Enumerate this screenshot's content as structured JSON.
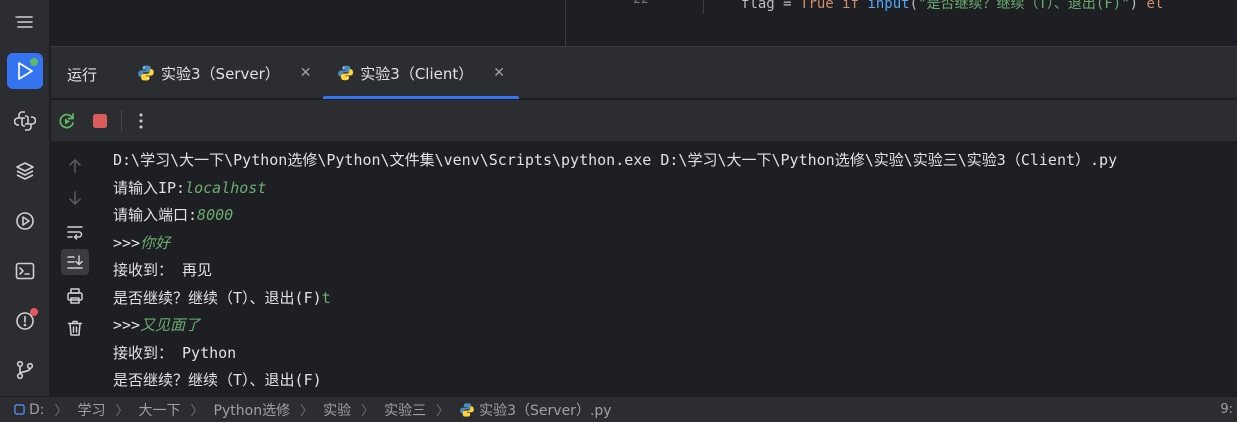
{
  "editor": {
    "line_number": "22",
    "code": {
      "ident": "flag",
      "eq": " = ",
      "kw_true": "True",
      "kw_if": " if ",
      "fn": "input",
      "paren_open": "(",
      "str": "\"是否继续？继续（T）、退出(F)\"",
      "paren_close": ")",
      "kw_else": " el"
    }
  },
  "run_panel": {
    "title": "运行",
    "tabs": [
      {
        "label": "实验3（Server）",
        "close": "✕",
        "active": false
      },
      {
        "label": "实验3（Client）",
        "close": "✕",
        "active": true
      }
    ]
  },
  "console": {
    "lines": [
      {
        "text": "D:\\学习\\大一下\\Python选修\\Python\\文件集\\venv\\Scripts\\python.exe D:\\学习\\大一下\\Python选修\\实验\\实验三\\实验3（Client）.py",
        "input": ""
      },
      {
        "text": "请输入IP:",
        "input": "localhost"
      },
      {
        "text": "请输入端口:",
        "input": "8000"
      },
      {
        "text": ">>>",
        "input": "你好"
      },
      {
        "text": "接收到： 再见",
        "input": ""
      },
      {
        "text": "是否继续？继续（T）、退出(F)",
        "input": "t"
      },
      {
        "text": ">>>",
        "input": "又见面了"
      },
      {
        "text": "接收到： Python",
        "input": ""
      },
      {
        "text": "是否继续？继续（T）、退出(F)",
        "input": ""
      }
    ]
  },
  "statusbar": {
    "breadcrumb": [
      "D:",
      "学习",
      "大一下",
      "Python选修",
      "实验",
      "实验三",
      "实验3（Server）.py"
    ],
    "right_text": "9:"
  },
  "icons": {
    "activity": [
      "menu-icon",
      "run-icon",
      "python-console-icon",
      "layers-icon",
      "services-icon",
      "terminal-icon",
      "problems-icon",
      "git-icon"
    ],
    "toolbar": [
      "rerun-icon",
      "stop-icon",
      "more-icon"
    ],
    "console_side": [
      "up-arrow-icon",
      "down-arrow-icon",
      "soft-wrap-icon",
      "scroll-to-end-icon",
      "print-icon",
      "trash-icon"
    ]
  },
  "colors": {
    "accent": "#3574f0",
    "stop": "#db5c5c",
    "rerun": "#5fb865",
    "input_text": "#6aab73",
    "badge_green": "#5fb865",
    "badge_red": "#e55765"
  }
}
